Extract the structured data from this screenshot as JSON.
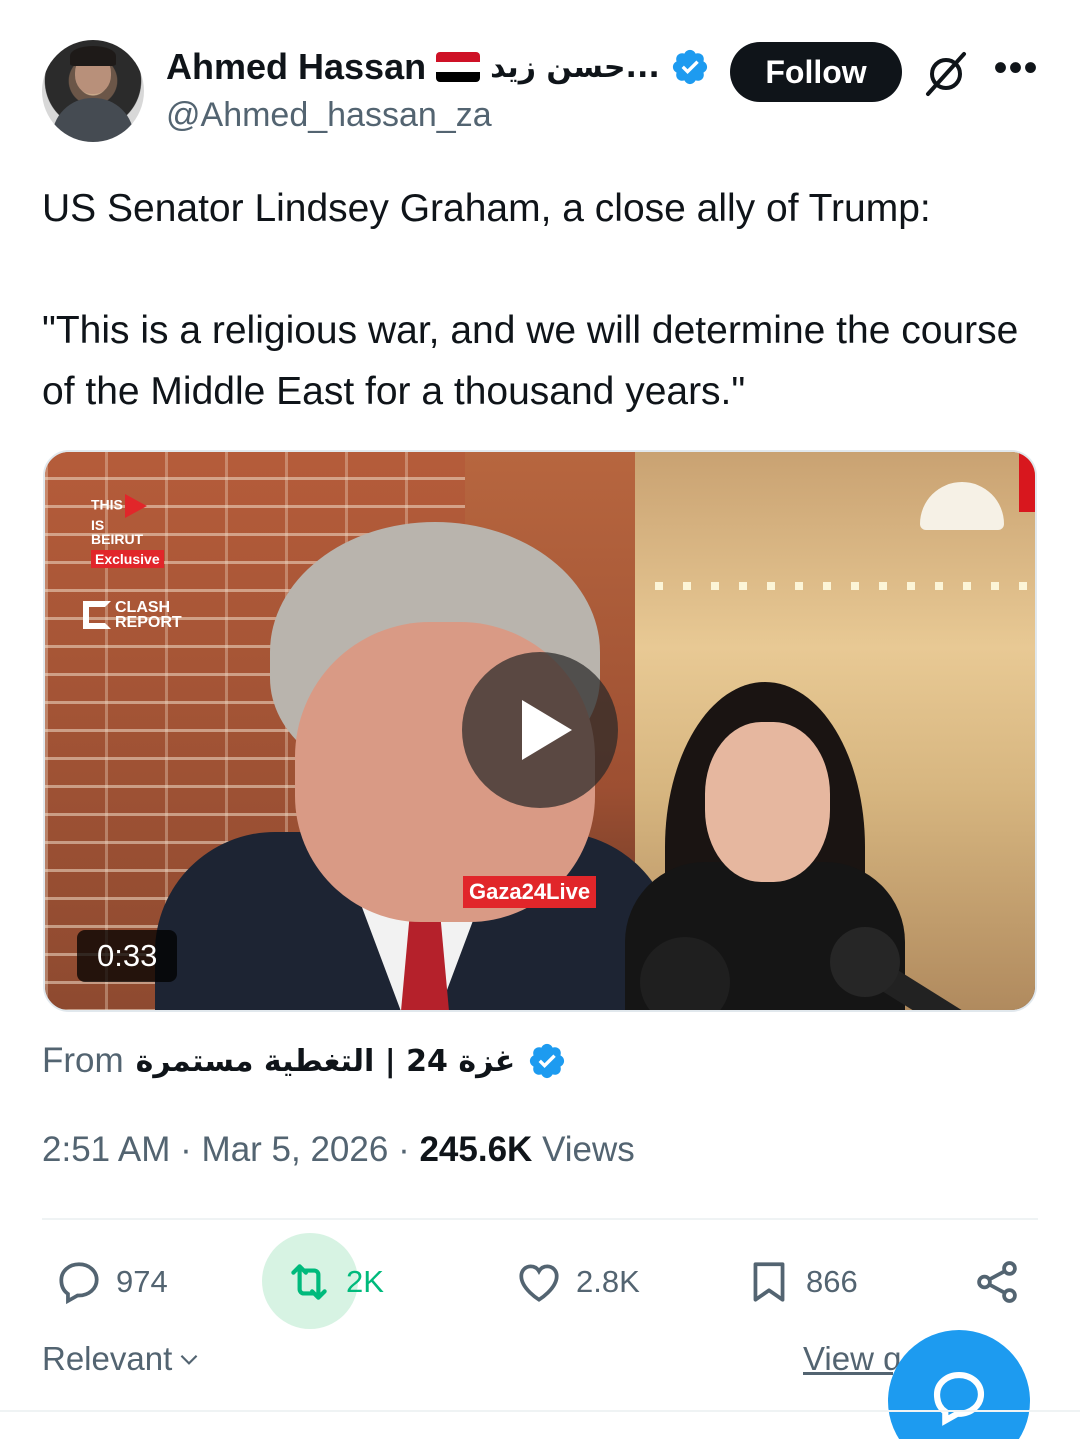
{
  "author": {
    "display_name": "Ahmed Hassan",
    "arabic_name": "...حسن زيد",
    "handle": "@Ahmed_hassan_za",
    "verified": true
  },
  "header": {
    "follow_label": "Follow",
    "grok_icon": "grok-slash-icon",
    "more_icon": "more-horizontal-icon",
    "more_glyph": "•••"
  },
  "tweet": {
    "line1": "US Senator Lindsey Graham, a close ally of Trump:",
    "line2": "\"This is a religious war, and we will determine the course of the Middle East for a thousand years.\""
  },
  "media": {
    "duration": "0:33",
    "overlay_logo_1": {
      "line1": "THIS",
      "line2": "IS",
      "line3": "BEIRUT",
      "tag": "Exclusive"
    },
    "overlay_logo_2": {
      "line1": "CLASH",
      "line2": "REPORT"
    },
    "watermark": "Gaza24Live"
  },
  "source": {
    "from_label": "From",
    "name": "غزة 24 | التغطية مستمرة",
    "verified": true
  },
  "meta": {
    "time": "2:51 AM",
    "separator": "·",
    "date": "Mar 5, 2026",
    "views_count": "245.6K",
    "views_label": "Views"
  },
  "actions": {
    "replies": "974",
    "reposts": "2K",
    "likes": "2.8K",
    "bookmarks": "866"
  },
  "footer": {
    "sort_label": "Relevant",
    "view_label": "View q",
    "chevron": "›"
  },
  "colors": {
    "accent": "#1d9bf0",
    "repost_green": "#00ba7c",
    "text_secondary": "#536471",
    "yemen_flag": [
      "#ce1126",
      "#ffffff",
      "#000000"
    ]
  }
}
